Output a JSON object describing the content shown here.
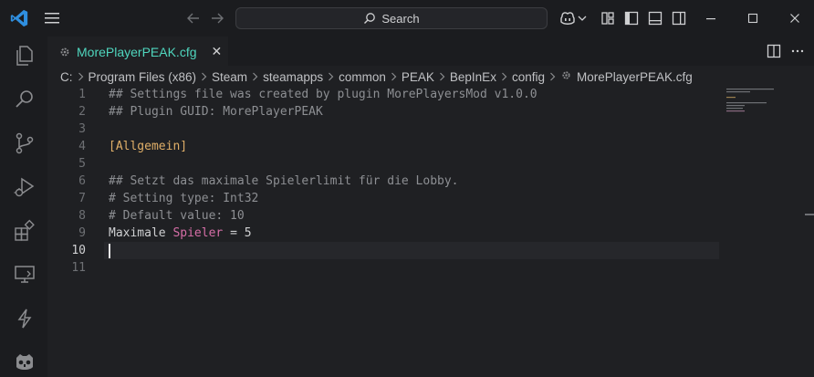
{
  "titlebar": {
    "search_label": "Search",
    "icons": [
      "vscode-logo",
      "menu-icon",
      "back-arrow-icon",
      "forward-arrow-icon",
      "copilot-icon",
      "chevron-down-icon",
      "layout-customize-icon",
      "toggle-primary-sidebar-icon",
      "toggle-panel-icon",
      "toggle-secondary-sidebar-icon"
    ],
    "window_controls": [
      "minimize",
      "maximize",
      "close"
    ]
  },
  "activity_bar": [
    "explorer-icon",
    "search-icon",
    "source-control-icon",
    "run-debug-icon",
    "extensions-icon",
    "remote-explorer-icon",
    "power-icon",
    "godot-icon"
  ],
  "tab": {
    "filename": "MorePlayerPEAK.cfg",
    "close": "✕"
  },
  "breadcrumb": {
    "segments": [
      "C:",
      "Program Files (x86)",
      "Steam",
      "steamapps",
      "common",
      "PEAK",
      "BepInEx",
      "config"
    ],
    "file": "MorePlayerPEAK.cfg"
  },
  "editor": {
    "active_line": 10,
    "lines": [
      {
        "n": "1",
        "text": "## Settings file was created by plugin MorePlayersMod v1.0.0"
      },
      {
        "n": "2",
        "text": "## Plugin GUID: MorePlayerPEAK"
      },
      {
        "n": "3",
        "text": ""
      },
      {
        "n": "4",
        "text": "[Allgemein]"
      },
      {
        "n": "5",
        "text": ""
      },
      {
        "n": "6",
        "text": "## Setzt das maximale Spielerlimit für die Lobby."
      },
      {
        "n": "7",
        "text": "# Setting type: Int32"
      },
      {
        "n": "8",
        "text": "# Default value: 10"
      },
      {
        "n": "9",
        "key1": "Maximale",
        "key2": "Spieler",
        "op": "=",
        "value": "5"
      },
      {
        "n": "10",
        "text": ""
      },
      {
        "n": "11",
        "text": ""
      }
    ]
  },
  "colors": {
    "accent_tab": "#4fd6be",
    "section": "#e0af68",
    "keyword": "#d66ea7",
    "comment": "#8d8f93"
  }
}
